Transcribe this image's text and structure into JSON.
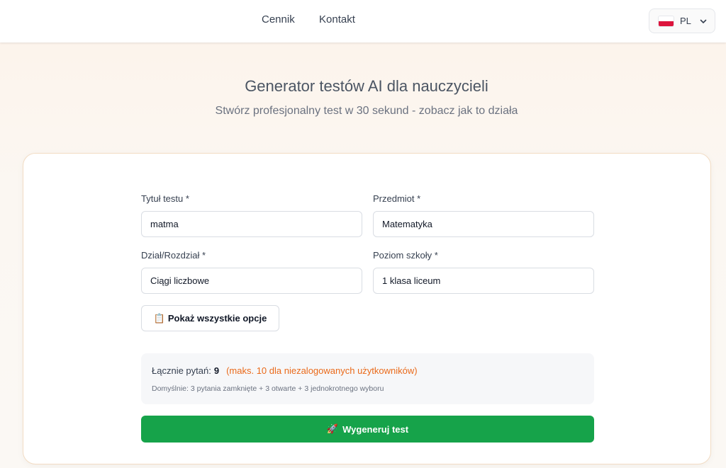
{
  "nav": {
    "links": [
      "Cennik",
      "Kontakt"
    ],
    "language": {
      "code": "PL",
      "flag_icon": "poland-flag-icon"
    }
  },
  "hero": {
    "title": "Generator testów AI dla nauczycieli",
    "subtitle": "Stwórz profesjonalny test w 30 sekund - zobacz jak to działa"
  },
  "form": {
    "title": {
      "label": "Tytuł testu *",
      "value": "matma"
    },
    "subject": {
      "label": "Przedmiot *",
      "value": "Matematyka"
    },
    "section": {
      "label": "Dział/Rozdział *",
      "value": "Ciągi liczbowe"
    },
    "level": {
      "label": "Poziom szkoły *",
      "value": "1 klasa liceum"
    },
    "options_button": {
      "icon": "📋",
      "label": "Pokaż wszystkie opcje"
    }
  },
  "summary": {
    "label": "Łącznie pytań:",
    "count": "9",
    "limit_note": "(maks. 10 dla niezalogowanych użytkowników)",
    "defaults": "Domyślnie: 3 pytania zamknięte + 3 otwarte + 3 jednokrotnego wyboru"
  },
  "generate_button": {
    "icon": "🚀",
    "label": "Wygeneruj test"
  },
  "colors": {
    "accent": "#16a34a",
    "warning": "#ea6a1a",
    "card_border": "#f2dcc4"
  }
}
